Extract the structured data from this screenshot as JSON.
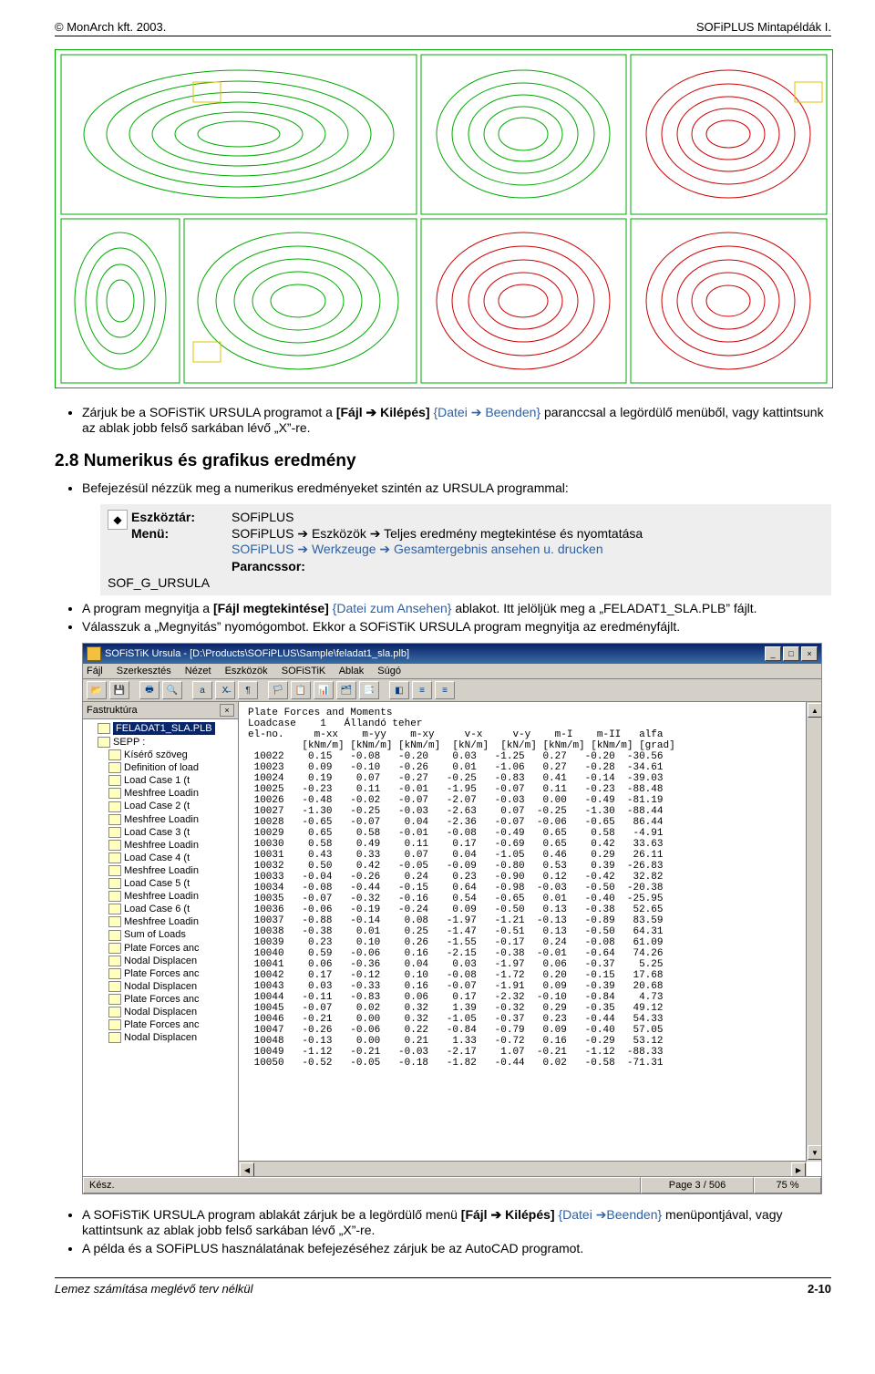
{
  "header": {
    "left": "© MonArch kft. 2003.",
    "right": "SOFiPLUS Mintapéldák I."
  },
  "para1": {
    "pre": "Zárjuk be a SOFiSTiK URSULA programot a ",
    "bold1": "[Fájl ➔ Kilépés]",
    "blue1": " {Datei ➔ Beenden}",
    "post": " paranccsal a legördülő menüből, vagy kattintsunk az ablak jobb felső sarkában lévő „X”-re."
  },
  "section_title": "2.8 Numerikus és grafikus eredmény",
  "para2": "Befejezésül nézzük meg a numerikus eredményeket szintén az URSULA programmal:",
  "box": {
    "k1": "Eszköztár:",
    "v1": "SOFiPLUS",
    "k2": "Menü:",
    "v2a": "SOFiPLUS ➔ Eszközök ➔ Teljes eredmény megtekintése és nyomtatása",
    "v2b": "SOFiPLUS ➔ Werkzeuge ➔ Gesamtergebnis ansehen u. drucken",
    "k3": "Parancssor:",
    "v3": "SOF_G_URSULA"
  },
  "para3": {
    "pre": "A program megnyitja a ",
    "bold": "[Fájl megtekintése]",
    "blue": " {Datei zum Ansehen}",
    "post": " ablakot. Itt jelöljük meg a „FELADAT1_SLA.PLB” fájlt."
  },
  "para4": "Válasszuk a „Megnyitás” nyomógombot. Ekkor a SOFiSTiK URSULA program megnyitja az eredményfájlt.",
  "app": {
    "title": "SOFiSTiK Ursula - [D:\\Products\\SOFiPLUS\\Sample\\feladat1_sla.plb]",
    "menu": [
      "Fájl",
      "Szerkesztés",
      "Nézet",
      "Eszközök",
      "SOFiSTiK",
      "Ablak",
      "Súgó"
    ],
    "tree_header": "Fastruktúra",
    "tree_root": "FELADAT1_SLA.PLB",
    "tree_items": [
      "SEPP :",
      "Kísérő szöveg",
      "Definition of load",
      "Load Case   1  (t",
      "Meshfree Loadin",
      "Load Case   2  (t",
      "Meshfree Loadin",
      "Load Case   3  (t",
      "Meshfree Loadin",
      "Load Case   4  (t",
      "Meshfree Loadin",
      "Load Case   5  (t",
      "Meshfree Loadin",
      "Load Case   6  (t",
      "Meshfree Loadin",
      "Sum of Loads",
      "Plate Forces anc",
      "Nodal Displacen",
      "Plate Forces anc",
      "Nodal Displacen",
      "Plate Forces anc",
      "Nodal Displacen",
      "Plate Forces anc",
      "Nodal Displacen"
    ],
    "content_title": "Plate Forces and Moments",
    "content_sub": "Loadcase    1   Állandó teher",
    "content_head": "el-no.     m-xx    m-yy    m-xy     v-x     v-y    m-I    m-II   alfa",
    "content_unit": "         [kNm/m] [kNm/m] [kNm/m]  [kN/m]  [kN/m] [kNm/m] [kNm/m] [grad]",
    "content_rows": [
      " 10022    0.15   -0.08   -0.20    0.03   -1.25   0.27   -0.20  -30.56",
      " 10023    0.09   -0.10   -0.26    0.01   -1.06   0.27   -0.28  -34.61",
      " 10024    0.19    0.07   -0.27   -0.25   -0.83   0.41   -0.14  -39.03",
      " 10025   -0.23    0.11   -0.01   -1.95   -0.07   0.11   -0.23  -88.48",
      " 10026   -0.48   -0.02   -0.07   -2.07   -0.03   0.00   -0.49  -81.19",
      " 10027   -1.30   -0.25   -0.03   -2.63    0.07  -0.25   -1.30  -88.44",
      " 10028   -0.65   -0.07    0.04   -2.36   -0.07  -0.06   -0.65   86.44",
      " 10029    0.65    0.58   -0.01   -0.08   -0.49   0.65    0.58   -4.91",
      " 10030    0.58    0.49    0.11    0.17   -0.69   0.65    0.42   33.63",
      " 10031    0.43    0.33    0.07    0.04   -1.05   0.46    0.29   26.11",
      " 10032    0.50    0.42   -0.05   -0.09   -0.80   0.53    0.39  -26.83",
      " 10033   -0.04   -0.26    0.24    0.23   -0.90   0.12   -0.42   32.82",
      " 10034   -0.08   -0.44   -0.15    0.64   -0.98  -0.03   -0.50  -20.38",
      " 10035   -0.07   -0.32   -0.16    0.54   -0.65   0.01   -0.40  -25.95",
      " 10036   -0.06   -0.19   -0.24    0.09   -0.50   0.13   -0.38   52.65",
      " 10037   -0.88   -0.14    0.08   -1.97   -1.21  -0.13   -0.89   83.59",
      " 10038   -0.38    0.01    0.25   -1.47   -0.51   0.13   -0.50   64.31",
      " 10039    0.23    0.10    0.26   -1.55   -0.17   0.24   -0.08   61.09",
      " 10040    0.59   -0.06    0.16   -2.15   -0.38  -0.01   -0.64   74.26",
      " 10041    0.06   -0.36    0.04    0.03   -1.97   0.06   -0.37    5.25",
      " 10042    0.17   -0.12    0.10   -0.08   -1.72   0.20   -0.15   17.68",
      " 10043    0.03   -0.33    0.16   -0.07   -1.91   0.09   -0.39   20.68",
      " 10044   -0.11   -0.83    0.06    0.17   -2.32  -0.10   -0.84    4.73",
      " 10045   -0.07    0.02    0.32    1.39   -0.32   0.29   -0.35   49.12",
      " 10046   -0.21    0.00    0.32   -1.05   -0.37   0.23   -0.44   54.33",
      " 10047   -0.26   -0.06    0.22   -0.84   -0.79   0.09   -0.40   57.05",
      " 10048   -0.13    0.00    0.21    1.33   -0.72   0.16   -0.29   53.12",
      " 10049   -1.12   -0.21   -0.03   -2.17    1.07  -0.21   -1.12  -88.33",
      " 10050   -0.52   -0.05   -0.18   -1.82   -0.44   0.02   -0.58  -71.31"
    ],
    "status_left": "Kész.",
    "status_page": "Page  3 / 506",
    "status_zoom": "75 %"
  },
  "para5": {
    "pre": "A SOFiSTiK URSULA program ablakát zárjuk be a legördülő menü ",
    "bold": "[Fájl ➔ Kilépés]",
    "blue": " {Datei ➔Beenden}",
    "post": " menüpontjával, vagy kattintsunk az ablak jobb felső sarkában lévő „X”-re."
  },
  "para6": "A példa és a SOFiPLUS használatának befejezéséhez zárjuk be az AutoCAD programot.",
  "footer": {
    "left": "Lemez számítása meglévő terv nélkül",
    "right": "2-10"
  }
}
